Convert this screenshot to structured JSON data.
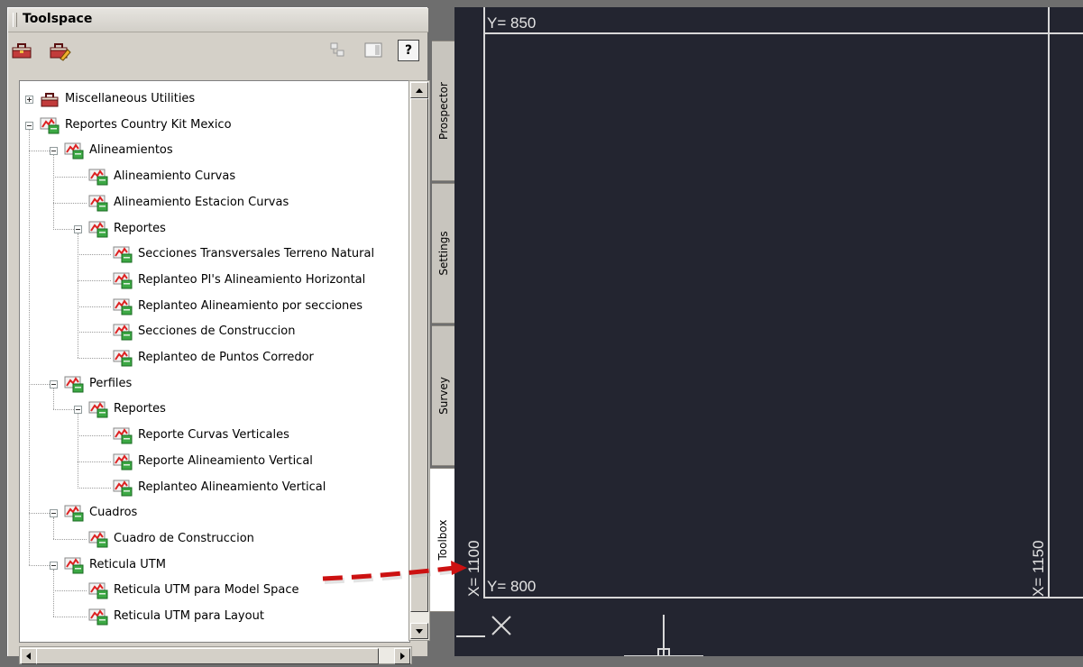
{
  "palette": {
    "title": "Toolspace",
    "toolbar": {
      "left_icons": [
        "toolbox-icon",
        "toolbox-edit-icon"
      ],
      "right_icons": [
        "tree-view-icon",
        "panel-icon",
        "help-icon"
      ],
      "help_label": "?"
    },
    "tree": [
      {
        "label": "Miscellaneous Utilities",
        "level": 0,
        "expander": "plus",
        "icon": "toolbox-icon"
      },
      {
        "label": "Reportes Country Kit Mexico",
        "level": 0,
        "expander": "minus",
        "icon": "report-icon"
      },
      {
        "label": "Alineamientos",
        "level": 1,
        "expander": "minus",
        "icon": "report-icon"
      },
      {
        "label": "Alineamiento Curvas",
        "level": 2,
        "expander": "none",
        "icon": "report-icon"
      },
      {
        "label": "Alineamiento Estacion Curvas",
        "level": 2,
        "expander": "none",
        "icon": "report-icon"
      },
      {
        "label": "Reportes",
        "level": 2,
        "expander": "minus",
        "icon": "report-icon"
      },
      {
        "label": "Secciones Transversales Terreno Natural",
        "level": 3,
        "expander": "none",
        "icon": "report-icon"
      },
      {
        "label": "Replanteo PI's Alineamiento Horizontal",
        "level": 3,
        "expander": "none",
        "icon": "report-icon"
      },
      {
        "label": "Replanteo Alineamiento por secciones",
        "level": 3,
        "expander": "none",
        "icon": "report-icon"
      },
      {
        "label": "Secciones de Construccion",
        "level": 3,
        "expander": "none",
        "icon": "report-icon"
      },
      {
        "label": "Replanteo de Puntos Corredor",
        "level": 3,
        "expander": "none",
        "icon": "report-icon"
      },
      {
        "label": "Perfiles",
        "level": 1,
        "expander": "minus",
        "icon": "report-icon"
      },
      {
        "label": "Reportes",
        "level": 2,
        "expander": "minus",
        "icon": "report-icon"
      },
      {
        "label": "Reporte Curvas Verticales",
        "level": 3,
        "expander": "none",
        "icon": "report-icon"
      },
      {
        "label": "Reporte Alineamiento Vertical",
        "level": 3,
        "expander": "none",
        "icon": "report-icon"
      },
      {
        "label": "Replanteo Alineamiento Vertical",
        "level": 3,
        "expander": "none",
        "icon": "report-icon"
      },
      {
        "label": "Cuadros",
        "level": 1,
        "expander": "minus",
        "icon": "report-icon"
      },
      {
        "label": "Cuadro de Construccion",
        "level": 2,
        "expander": "none",
        "icon": "report-icon"
      },
      {
        "label": "Reticula UTM",
        "level": 1,
        "expander": "minus",
        "icon": "report-icon"
      },
      {
        "label": "Reticula UTM para Model Space",
        "level": 2,
        "expander": "none",
        "icon": "report-icon"
      },
      {
        "label": "Reticula UTM para Layout",
        "level": 2,
        "expander": "none",
        "icon": "report-icon"
      }
    ],
    "tabs": [
      {
        "label": "Prospector",
        "active": false
      },
      {
        "label": "Settings",
        "active": false
      },
      {
        "label": "Survey",
        "active": false
      },
      {
        "label": "Toolbox",
        "active": true
      }
    ]
  },
  "drawing": {
    "background": "#232530",
    "labels": {
      "y_top": "Y= 850",
      "y_bottom": "Y= 800",
      "x_left": "X= 1100",
      "x_right": "X= 1150"
    },
    "annotation_arrow_color": "#cc1111"
  }
}
